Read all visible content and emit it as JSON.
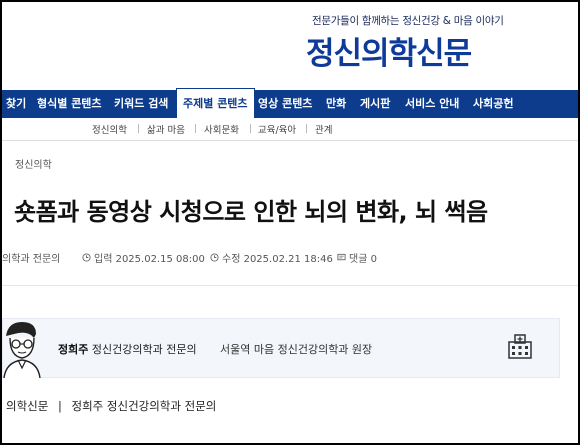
{
  "header": {
    "tagline": "전문가들이 함께하는 정신건강 & 마음 이야기",
    "logo": "정신의학신문"
  },
  "nav": {
    "items": [
      {
        "label": "찾기"
      },
      {
        "label": "형식별 콘텐츠"
      },
      {
        "label": "키워드 검색"
      },
      {
        "label": "주제별 콘텐츠"
      },
      {
        "label": "영상 콘텐츠"
      },
      {
        "label": "만화"
      },
      {
        "label": "게시판"
      },
      {
        "label": "서비스 안내"
      },
      {
        "label": "사회공헌"
      }
    ],
    "active_index": 3
  },
  "subnav": {
    "items": [
      "정신의학",
      "삶과 마음",
      "사회문화",
      "교육/육아",
      "관계"
    ]
  },
  "article": {
    "section": "정신의학",
    "title": "숏폼과 동영상 시청으로 인한 뇌의 변화, 뇌 썩음",
    "author_short": "의학과 전문의",
    "published": "입력 2025.02.15 08:00",
    "modified": "수정 2025.02.21 18:46",
    "comments": "댓글 0"
  },
  "author_box": {
    "name": "정희주",
    "title": "정신건강의학과 전문의",
    "affiliation": "서울역 마음 정신건강의학과 원장"
  },
  "byline": {
    "source": "의학신문",
    "separator": "|",
    "author": "정희주 정신건강의학과 전문의"
  },
  "colors": {
    "brand": "#0e3a99",
    "navbar": "#0d3c8c",
    "author_box_bg": "#f3f6fb"
  }
}
